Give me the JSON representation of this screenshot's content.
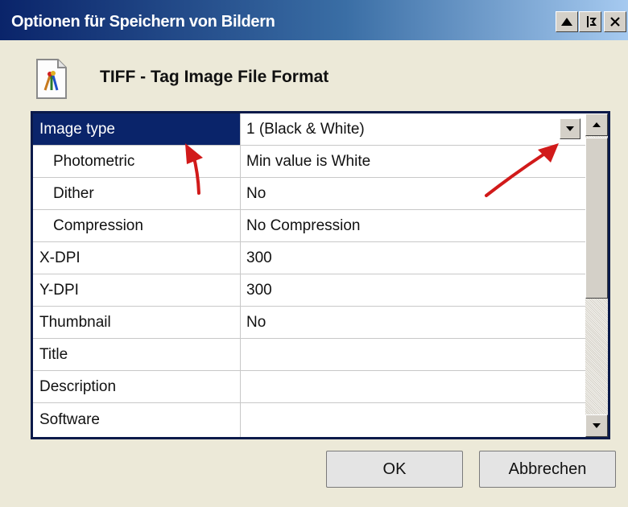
{
  "window": {
    "title": "Optionen für Speichern von Bildern",
    "controls": [
      "minimize-icon",
      "help-icon",
      "close-icon"
    ]
  },
  "header": {
    "icon": "tiff-file-icon",
    "title": "TIFF - Tag Image File Format"
  },
  "properties": [
    {
      "name": "Image type",
      "value": "1 (Black & White)",
      "selected": true,
      "has_dropdown": true
    },
    {
      "name": "Photometric",
      "value": "Min value is White",
      "indent": true
    },
    {
      "name": "Dither",
      "value": "No",
      "indent": true
    },
    {
      "name": "Compression",
      "value": "No Compression",
      "indent": true
    },
    {
      "name": "X-DPI",
      "value": "300"
    },
    {
      "name": "Y-DPI",
      "value": "300"
    },
    {
      "name": "Thumbnail",
      "value": "No"
    },
    {
      "name": "Title",
      "value": ""
    },
    {
      "name": "Description",
      "value": ""
    },
    {
      "name": "Software",
      "value": ""
    }
  ],
  "buttons": {
    "ok": "OK",
    "cancel": "Abbrechen"
  },
  "colors": {
    "selection": "#0a246a",
    "annotation_arrow": "#d11a1a"
  }
}
